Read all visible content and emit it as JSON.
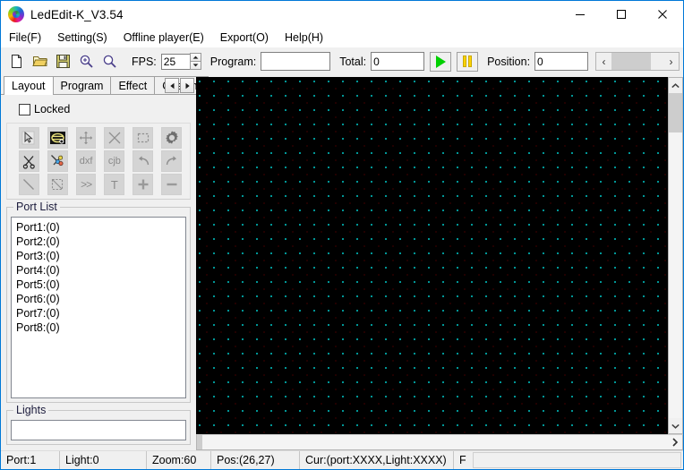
{
  "window": {
    "title": "LedEdit-K_V3.54",
    "icon": "rainbow-spiral-icon",
    "minimize_label": "─",
    "maximize_label": "□",
    "close_label": "✕"
  },
  "menubar": {
    "items": [
      {
        "label": "File(F)"
      },
      {
        "label": "Setting(S)"
      },
      {
        "label": "Offline player(E)"
      },
      {
        "label": "Export(O)"
      },
      {
        "label": "Help(H)"
      }
    ]
  },
  "toolbar": {
    "buttons": [
      {
        "name": "new-file-icon",
        "glyph": "new"
      },
      {
        "name": "open-folder-icon",
        "glyph": "open"
      },
      {
        "name": "save-icon",
        "glyph": "save"
      },
      {
        "name": "zoom-in-icon",
        "glyph": "zoom-in"
      },
      {
        "name": "zoom-out-icon",
        "glyph": "zoom-out"
      }
    ],
    "fps_label": "FPS:",
    "fps_value": "25",
    "program_label": "Program:",
    "program_value": "",
    "total_label": "Total:",
    "total_value": "0",
    "play_label": "▶",
    "pause_label": "‖",
    "position_label": "Position:",
    "position_value": "0",
    "scroll_left": "‹",
    "scroll_right": "›"
  },
  "left_panel": {
    "tabs": [
      {
        "label": "Layout",
        "active": true
      },
      {
        "label": "Program",
        "active": false
      },
      {
        "label": "Effect",
        "active": false
      },
      {
        "label": "Custom",
        "active": false
      }
    ],
    "tab_prev": "◄",
    "tab_next": "►",
    "locked_label": "Locked",
    "locked_checked": false,
    "tools": [
      [
        {
          "name": "select-arrow-tool",
          "label": "",
          "enabled": true
        },
        {
          "name": "layout-shape-tool",
          "label": "",
          "enabled": true
        },
        {
          "name": "move-tool",
          "label": "",
          "enabled": false
        },
        {
          "name": "delete-cross-tool",
          "label": "",
          "enabled": false
        },
        {
          "name": "marquee-select-tool",
          "label": "",
          "enabled": false
        },
        {
          "name": "settings-gear-tool",
          "label": "",
          "enabled": true
        }
      ],
      [
        {
          "name": "cut-scissors-tool",
          "label": "",
          "enabled": true
        },
        {
          "name": "color-mix-tool",
          "label": "",
          "enabled": true
        },
        {
          "name": "dxf-import-tool",
          "label": "dxf",
          "enabled": false
        },
        {
          "name": "cjb-import-tool",
          "label": "cjb",
          "enabled": false
        },
        {
          "name": "undo-tool",
          "label": "",
          "enabled": false
        },
        {
          "name": "redo-tool",
          "label": "",
          "enabled": false
        }
      ],
      [
        {
          "name": "line-draw-tool",
          "label": "",
          "enabled": false
        },
        {
          "name": "rect-draw-tool",
          "label": "",
          "enabled": false
        },
        {
          "name": "forward-tool",
          "label": ">>",
          "enabled": false
        },
        {
          "name": "text-tool",
          "label": "T",
          "enabled": false
        },
        {
          "name": "add-tool",
          "label": "",
          "enabled": false
        },
        {
          "name": "minus-tool",
          "label": "",
          "enabled": false
        }
      ]
    ],
    "port_list_title": "Port List",
    "ports": [
      {
        "label": "Port1:(0)"
      },
      {
        "label": "Port2:(0)"
      },
      {
        "label": "Port3:(0)"
      },
      {
        "label": "Port4:(0)"
      },
      {
        "label": "Port5:(0)"
      },
      {
        "label": "Port6:(0)"
      },
      {
        "label": "Port7:(0)"
      },
      {
        "label": "Port8:(0)"
      }
    ],
    "lights_title": "Lights",
    "lights_value": ""
  },
  "canvas": {
    "background_color": "#000000",
    "dot_color": "#00d2d2",
    "grid_spacing_px": 16,
    "v_scroll_up": "ⱎ",
    "v_scroll_down": "ⱟ",
    "h_scroll_right": "❯"
  },
  "statusbar": {
    "cells": [
      {
        "name": "status-port",
        "label": "Port:1"
      },
      {
        "name": "status-light",
        "label": "Light:0"
      },
      {
        "name": "status-zoom",
        "label": "Zoom:60"
      },
      {
        "name": "status-pos",
        "label": "Pos:(26,27)"
      },
      {
        "name": "status-cursor",
        "label": "Cur:(port:XXXX,Light:XXXX)"
      },
      {
        "name": "status-f",
        "label": "F"
      }
    ]
  },
  "colors": {
    "accent": "#0078d7",
    "window_bg": "#f0f0f0",
    "canvas_bg": "#000000",
    "play_green": "#00d000",
    "pause_yellow": "#ffd400"
  }
}
